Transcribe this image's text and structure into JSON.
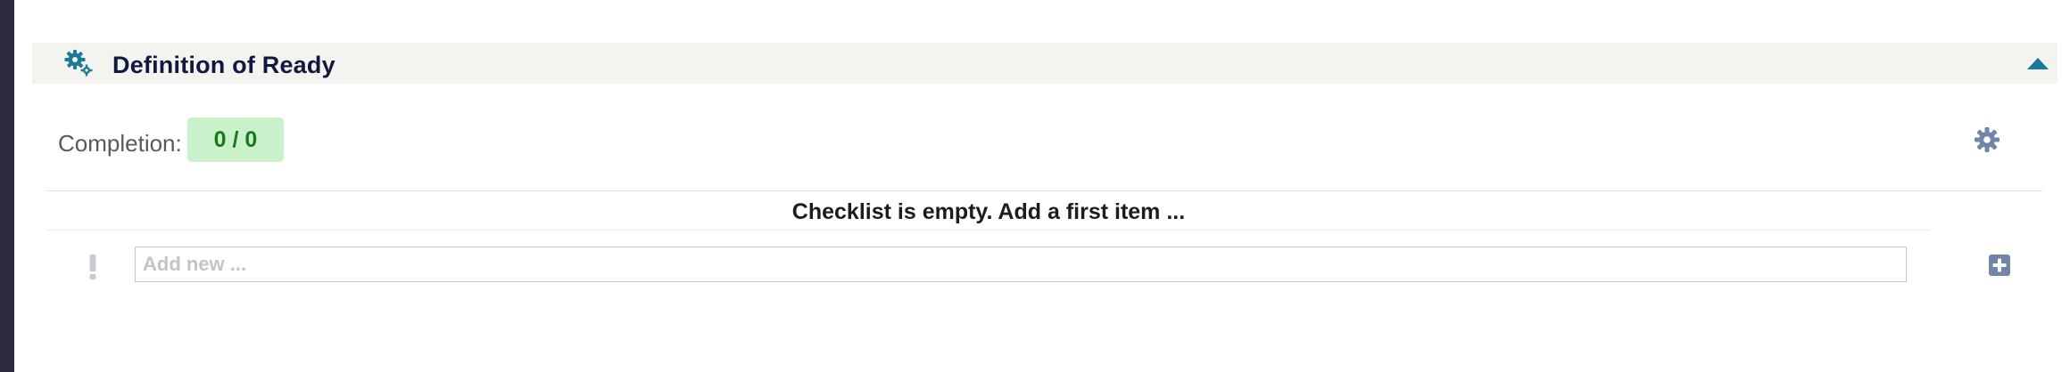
{
  "section": {
    "title": "Definition of Ready",
    "icon": "gears-icon",
    "toggle_icon": "caret-up-icon"
  },
  "completion": {
    "label": "Completion:",
    "value": "0 / 0"
  },
  "checklist": {
    "empty_message": "Checklist is empty. Add a first item ...",
    "new_item": {
      "placeholder": "Add new ...",
      "value": ""
    }
  },
  "icons": {
    "settings": "gear-icon",
    "priority": "exclamation-icon",
    "add": "plus-square-icon"
  },
  "colors": {
    "accent": "#1b7a99",
    "icon_muted": "#6f86a8",
    "badge_bg": "#c9f2cb",
    "badge_text": "#177a1c",
    "header_bg": "#f3f3f0"
  }
}
